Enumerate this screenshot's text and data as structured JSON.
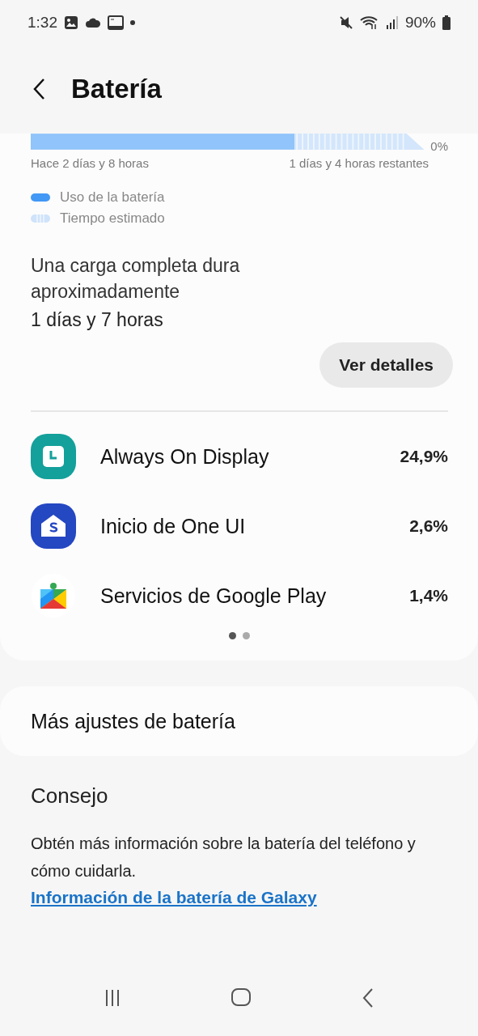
{
  "status_bar": {
    "time": "1:32",
    "battery_percent": "90%"
  },
  "header": {
    "title": "Batería"
  },
  "usage_graph": {
    "end_label": "0%",
    "start_time": "Hace 2 días y 8 horas",
    "remaining": "1 días y 4 horas restantes"
  },
  "legend": [
    {
      "kind": "solid",
      "label": "Uso de la batería"
    },
    {
      "kind": "striped",
      "label": "Tiempo estimado"
    }
  ],
  "full_charge": {
    "text": "Una carga completa dura aproximadamente",
    "duration": "1 días y 7 horas"
  },
  "details_button": "Ver detalles",
  "apps": [
    {
      "kind": "clock",
      "name": "Always On Display",
      "percent": "24,9%"
    },
    {
      "kind": "home",
      "name": "Inicio de One UI",
      "percent": "2,6%"
    },
    {
      "kind": "puzzle",
      "name": "Servicios de Google Play",
      "percent": "1,4%"
    }
  ],
  "pages": [
    {
      "selected": true
    },
    {
      "selected": false
    }
  ],
  "more_settings": "Más ajustes de batería",
  "tip": {
    "title": "Consejo",
    "text": "Obtén más información sobre la batería del teléfono y cómo cuidarla.",
    "link": "Información de la batería de Galaxy"
  }
}
